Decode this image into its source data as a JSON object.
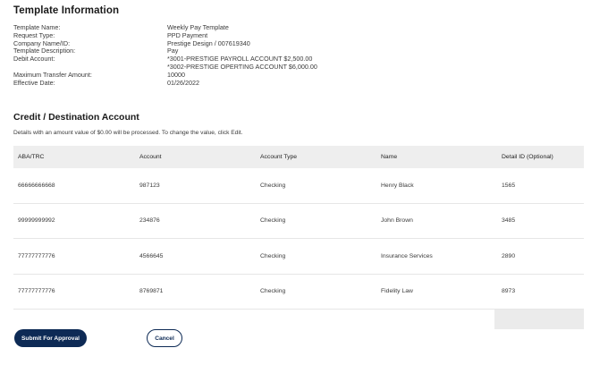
{
  "template_info": {
    "title": "Template Information",
    "fields": [
      {
        "label": "Template Name:",
        "values": [
          "Weekly Pay Template"
        ]
      },
      {
        "label": "Request Type:",
        "values": [
          "PPD Payment"
        ]
      },
      {
        "label": "Company Name/ID:",
        "values": [
          "Prestige Design / 007619340"
        ]
      },
      {
        "label": "Template Description:",
        "values": [
          "Pay"
        ]
      },
      {
        "label": "Debit Account:",
        "values": [
          "*3001-PRESTIGE PAYROLL ACCOUNT $2,500.00",
          "*3002-PRESTIGE OPERTING ACCOUNT $6,000.00"
        ]
      },
      {
        "label": "Maximum Transfer Amount:",
        "values": [
          "10000"
        ]
      },
      {
        "label": "Effective Date:",
        "values": [
          "01/26/2022"
        ]
      }
    ]
  },
  "credit_section": {
    "title": "Credit / Destination Account",
    "note": "Details with an amount value of $0.00 will be processed. To change the value, click Edit.",
    "columns": [
      "ABA/TRC",
      "Account",
      "Account Type",
      "Name",
      "Detail ID (Optional)"
    ],
    "rows": [
      [
        "66666666668",
        "987123",
        "Checking",
        "Henry Black",
        "1565"
      ],
      [
        "99999999992",
        "234876",
        "Checking",
        "John Brown",
        "3485"
      ],
      [
        "77777777776",
        "4566645",
        "Checking",
        "Insurance Services",
        "2890"
      ],
      [
        "77777777776",
        "8769871",
        "Checking",
        "Fidelity Law",
        "8973"
      ]
    ]
  },
  "actions": {
    "submit_label": "Submit For Approval",
    "cancel_label": "Cancel"
  },
  "colors": {
    "primary": "#0d2a55",
    "header_bg": "#eeeeee"
  }
}
